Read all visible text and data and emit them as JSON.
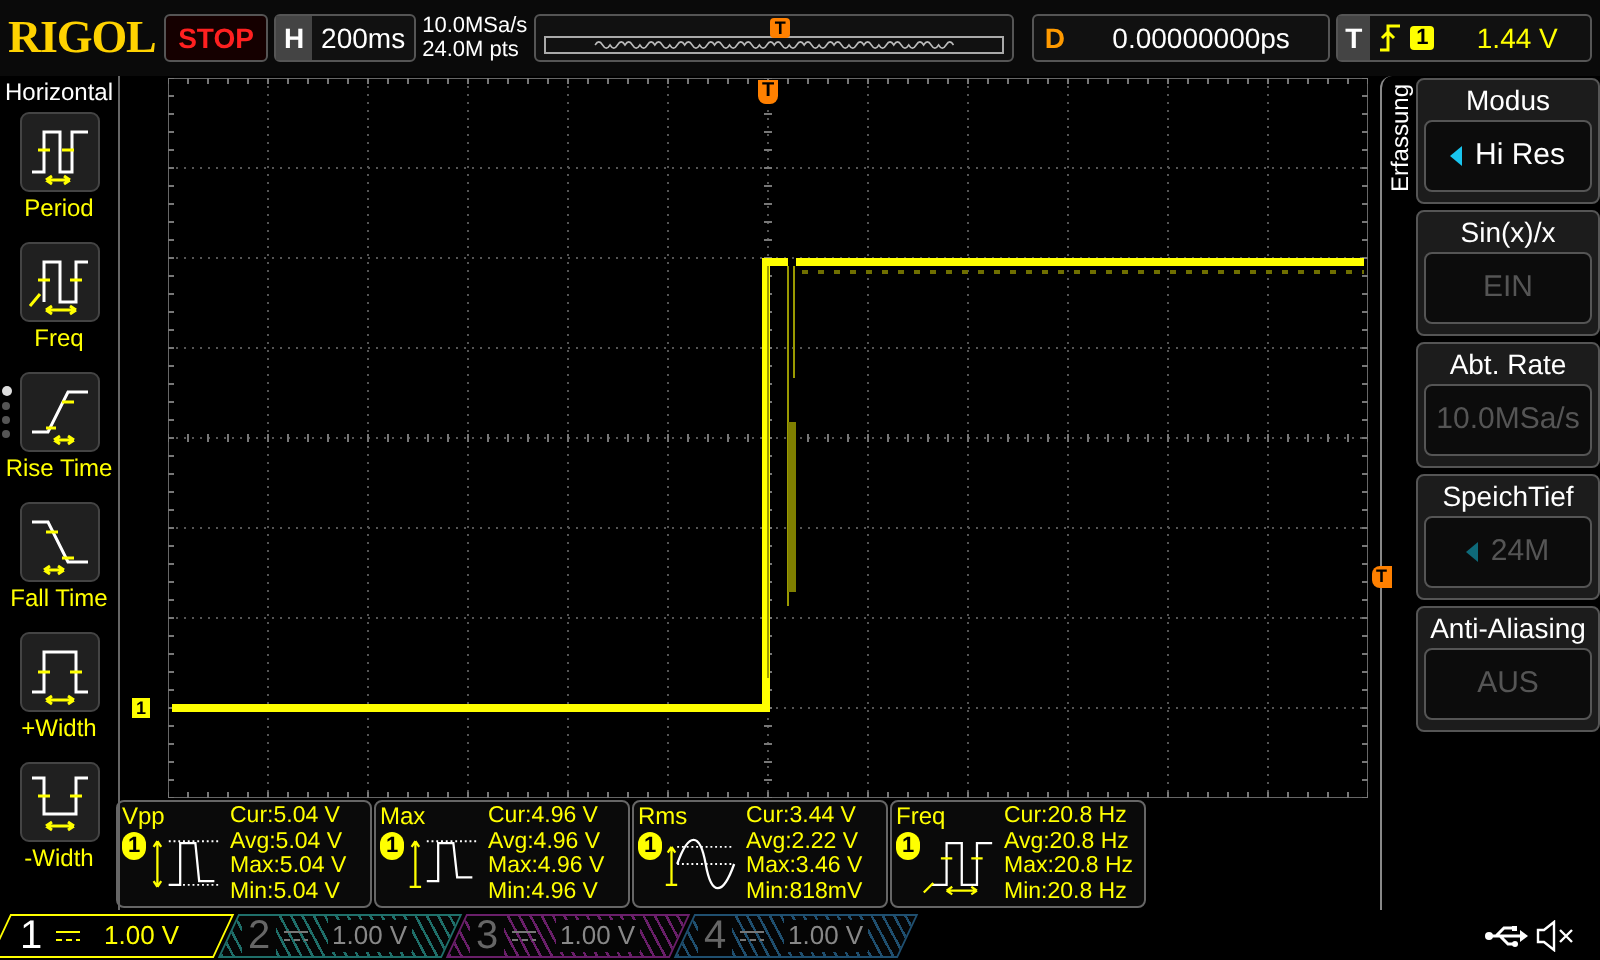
{
  "top_bar": {
    "logo": "RIGOL",
    "run_state": "STOP",
    "horizontal": {
      "label": "H",
      "timebase": "200ms"
    },
    "sample_rate": "10.0MSa/s",
    "memory_depth": "24.0M pts",
    "overview_marker": "T",
    "delay": {
      "label": "D",
      "value": "0.00000000ps"
    },
    "trigger": {
      "label": "T",
      "channel": "1",
      "level": "1.44 V"
    }
  },
  "sidebar": {
    "title": "Horizontal",
    "page_dots": [
      {
        "selected": true
      },
      {
        "selected": false
      },
      {
        "selected": false
      },
      {
        "selected": false
      }
    ],
    "items": [
      {
        "label": "Period",
        "kind": "period"
      },
      {
        "label": "Freq",
        "kind": "freq"
      },
      {
        "label": "Rise Time",
        "kind": "rise"
      },
      {
        "label": "Fall Time",
        "kind": "fall"
      },
      {
        "label": "+Width",
        "kind": "pwidth"
      },
      {
        "label": "-Width",
        "kind": "nwidth"
      }
    ]
  },
  "graticule": {
    "trigger_position_marker": "T",
    "channel_marker": "1",
    "trigger_level_marker": "T"
  },
  "measurements": [
    {
      "name": "Vpp",
      "channel": "1",
      "kind": "vpp",
      "stats": [
        "Cur:5.04 V",
        "Avg:5.04 V",
        "Max:5.04 V",
        "Min:5.04 V"
      ]
    },
    {
      "name": "Max",
      "channel": "1",
      "kind": "max",
      "stats": [
        "Cur:4.96 V",
        "Avg:4.96 V",
        "Max:4.96 V",
        "Min:4.96 V"
      ]
    },
    {
      "name": "Rms",
      "channel": "1",
      "kind": "rms",
      "stats": [
        "Cur:3.44 V",
        "Avg:2.22 V",
        "Max:3.46 V",
        "Min:818mV"
      ]
    },
    {
      "name": "Freq",
      "channel": "1",
      "kind": "freq",
      "stats": [
        "Cur:20.8 Hz",
        "Avg:20.8 Hz",
        "Max:20.8 Hz",
        "Min:20.8 Hz"
      ]
    }
  ],
  "menu": {
    "title": "Erfassung",
    "items": [
      {
        "label": "Modus",
        "value": "Hi Res",
        "disabled": false,
        "arrow": true
      },
      {
        "label": "Sin(x)/x",
        "value": "EIN",
        "disabled": true,
        "arrow": false
      },
      {
        "label": "Abt. Rate",
        "value": "10.0MSa/s",
        "disabled": true,
        "arrow": false
      },
      {
        "label": "SpeichTief",
        "value": "24M",
        "disabled": true,
        "arrow": true
      },
      {
        "label": "Anti-Aliasing",
        "value": "AUS",
        "disabled": true,
        "arrow": false
      }
    ]
  },
  "channels": [
    {
      "number": "1",
      "scale": "1.00 V",
      "selected": true,
      "color": "#ffff00"
    },
    {
      "number": "2",
      "scale": "1.00 V",
      "selected": false,
      "color": "#1f6f6a"
    },
    {
      "number": "3",
      "scale": "1.00 V",
      "selected": false,
      "color": "#6a1f6a"
    },
    {
      "number": "4",
      "scale": "1.00 V",
      "selected": false,
      "color": "#1f4f6f"
    }
  ]
}
